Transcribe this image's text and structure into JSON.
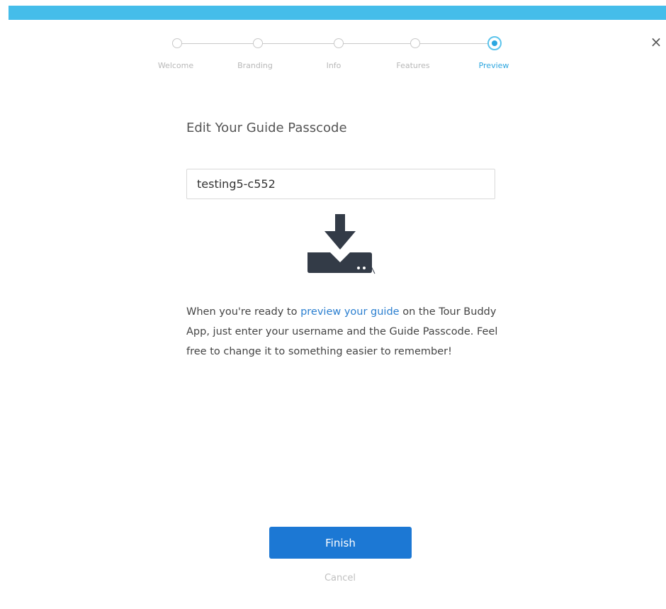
{
  "dialog": {
    "close_icon": "close-icon",
    "close_glyph": "×"
  },
  "stepper": {
    "steps": [
      {
        "label": "Welcome",
        "state": "completed"
      },
      {
        "label": "Branding",
        "state": "completed"
      },
      {
        "label": "Info",
        "state": "completed"
      },
      {
        "label": "Features",
        "state": "completed"
      },
      {
        "label": "Preview",
        "state": "active"
      }
    ],
    "active_color": "#2ea6df"
  },
  "main": {
    "title": "Edit Your Guide Passcode",
    "passcode_value": "testing5-c552",
    "icon": "download-icon",
    "description_before": "When you're ready to ",
    "description_link": "preview your guide",
    "description_after": " on the Tour Buddy App, just enter your username and the Guide Passcode. Feel free to change it to something easier to remember!"
  },
  "footer": {
    "finish_label": "Finish",
    "cancel_label": "Cancel"
  },
  "colors": {
    "top_bar": "#45bdea",
    "primary_button": "#1c78d4",
    "link": "#2b7fd0"
  }
}
